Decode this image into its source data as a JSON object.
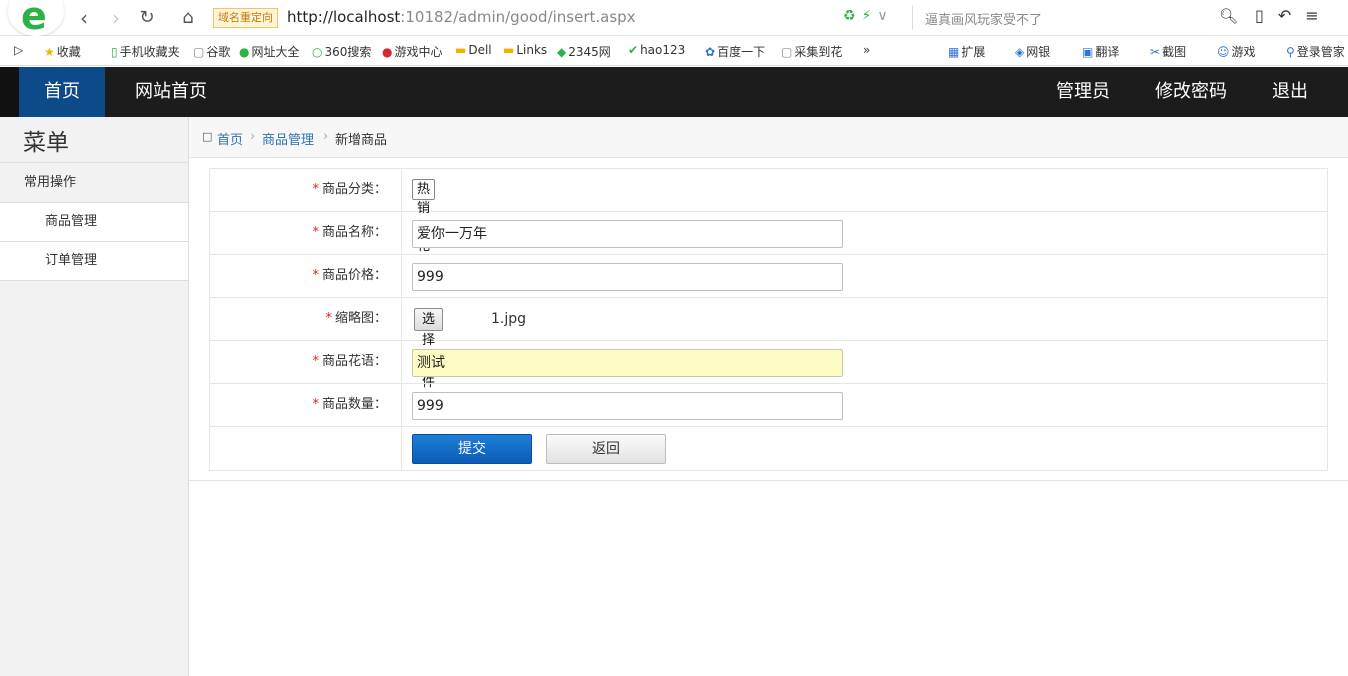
{
  "browser": {
    "logo_letter": "e",
    "redirect_badge": "域名重定向",
    "url_host": "http://localhost",
    "url_rest": ":10182/admin/good/insert.aspx",
    "search_placeholder": "逼真画风玩家受不了",
    "bookmarks": [
      {
        "icon": "★",
        "label": "收藏",
        "color": "#f0b400"
      },
      {
        "icon": "▯",
        "label": "手机收藏夹",
        "color": "#2bb34a"
      },
      {
        "icon": "▢",
        "label": "谷歌",
        "color": "#888888"
      },
      {
        "icon": "●",
        "label": "网址大全",
        "color": "#2bb34a"
      },
      {
        "icon": "○",
        "label": "360搜索",
        "color": "#2bb34a"
      },
      {
        "icon": "●",
        "label": "游戏中心",
        "color": "#d9262f"
      },
      {
        "icon": "▬",
        "label": "Dell",
        "color": "#f0b400"
      },
      {
        "icon": "▬",
        "label": "Links",
        "color": "#f0b400"
      },
      {
        "icon": "◆",
        "label": "2345网",
        "color": "#2bb34a"
      },
      {
        "icon": "✔",
        "label": "hao123",
        "color": "#2bb34a"
      },
      {
        "icon": "✿",
        "label": "百度一下",
        "color": "#2f73d9"
      },
      {
        "icon": "▢",
        "label": "采集到花",
        "color": "#888888"
      }
    ],
    "bookmarks_right": [
      {
        "icon": "▦",
        "label": "扩展"
      },
      {
        "icon": "◈",
        "label": "网银"
      },
      {
        "icon": "▣",
        "label": "翻译"
      },
      {
        "icon": "✂",
        "label": "截图"
      },
      {
        "icon": "☺",
        "label": "游戏"
      },
      {
        "icon": "⚲",
        "label": "登录管家"
      }
    ],
    "more_label": "»"
  },
  "header": {
    "nav_left": [
      {
        "label": "首页",
        "active": true
      },
      {
        "label": "网站首页",
        "active": false
      }
    ],
    "nav_right": [
      {
        "label": "管理员"
      },
      {
        "label": "修改密码"
      },
      {
        "label": "退出"
      }
    ],
    "colors": {
      "bg": "#1c1c1c",
      "active": "#0d4a8a"
    }
  },
  "sidebar": {
    "title": "菜单",
    "group": "常用操作",
    "items": [
      {
        "label": "商品管理"
      },
      {
        "label": "订单管理"
      }
    ]
  },
  "breadcrumb": {
    "home_icon": "home-icon",
    "items": [
      "首页",
      "商品管理",
      "新增商品"
    ]
  },
  "form": {
    "fields": [
      {
        "label": "商品分类：",
        "type": "select",
        "value": "热销鲜花"
      },
      {
        "label": "商品名称：",
        "type": "text",
        "value": "爱你一万年"
      },
      {
        "label": "商品价格：",
        "type": "text",
        "value": "999"
      },
      {
        "label": "缩略图：",
        "type": "file",
        "button": "选择文件",
        "value": "1.jpg"
      },
      {
        "label": "商品花语：",
        "type": "text",
        "value": "测试",
        "focused": true
      },
      {
        "label": "商品数量：",
        "type": "text",
        "value": "999"
      }
    ],
    "required_mark": "*",
    "submit_label": "提交",
    "back_label": "返回"
  }
}
